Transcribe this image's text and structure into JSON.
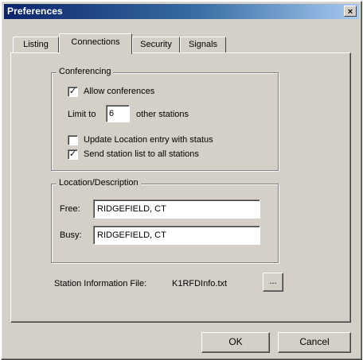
{
  "window": {
    "title": "Preferences",
    "close_glyph": "×"
  },
  "tabs": [
    {
      "label": "Listing"
    },
    {
      "label": "Connections"
    },
    {
      "label": "Security"
    },
    {
      "label": "Signals"
    }
  ],
  "active_tab": "Connections",
  "conferencing": {
    "group_label": "Conferencing",
    "allow_conferences": {
      "label": "Allow conferences",
      "checked": true
    },
    "limit_prefix": "Limit to",
    "limit_value": "6",
    "limit_suffix": "other stations",
    "update_location": {
      "label": "Update Location entry with status",
      "checked": false
    },
    "send_station_list": {
      "label": "Send station list to all stations",
      "checked": true
    }
  },
  "location": {
    "group_label": "Location/Description",
    "free_label": "Free:",
    "free_value": "RIDGEFIELD, CT",
    "busy_label": "Busy:",
    "busy_value": "RIDGEFIELD, CT"
  },
  "station_info": {
    "label": "Station Information File:",
    "filename": "K1RFDInfo.txt",
    "browse_label": "..."
  },
  "footer": {
    "ok_label": "OK",
    "cancel_label": "Cancel"
  },
  "check_glyph": "✓"
}
